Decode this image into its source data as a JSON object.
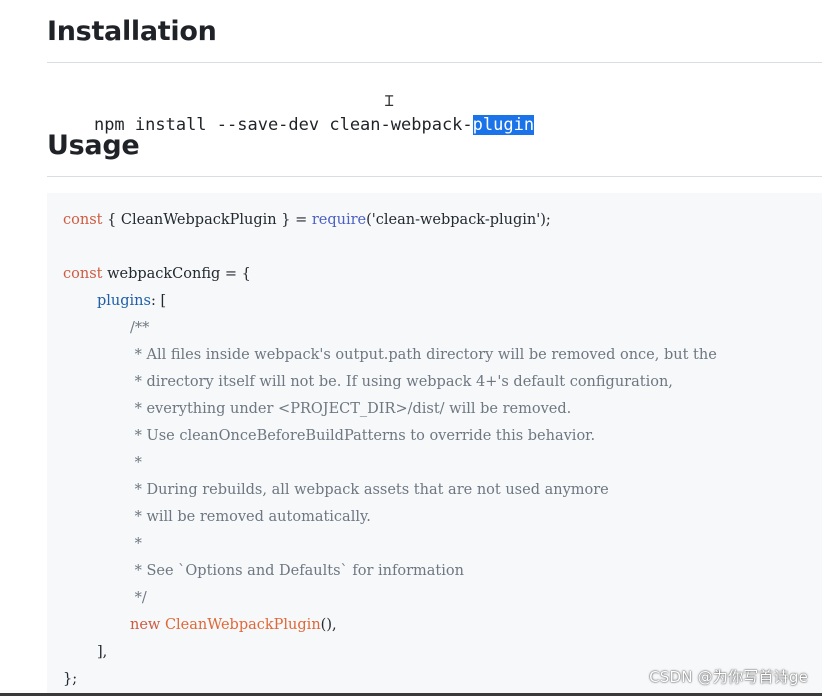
{
  "headings": {
    "installation": "Installation",
    "usage": "Usage"
  },
  "install": {
    "command_before": "npm install --save-dev clean-webpack-",
    "command_selected": "plugin"
  },
  "code": {
    "line1": {
      "const": "const",
      "braces": " { CleanWebpackPlugin } ",
      "eq": "= ",
      "require": "require",
      "arg": "('clean-webpack-plugin');"
    },
    "line3": {
      "const": "const",
      "name": " webpackConfig ",
      "eq": "= {"
    },
    "line4": {
      "plugins": "plugins",
      "rest": ": ["
    },
    "comment": [
      "/**",
      " * All files inside webpack's output.path directory will be removed once, but the",
      " * directory itself will not be. If using webpack 4+'s default configuration,",
      " * everything under <PROJECT_DIR>/dist/ will be removed.",
      " * Use cleanOnceBeforeBuildPatterns to override this behavior.",
      " *",
      " * During rebuilds, all webpack assets that are not used anymore",
      " * will be removed automatically.",
      " *",
      " * See `Options and Defaults` for information",
      " */"
    ],
    "line_new": {
      "new": "new",
      "cls": " CleanWebpackPlugin",
      "rest": "(),"
    },
    "close_array": "],",
    "close_obj": "};"
  },
  "watermark": "CSDN @为你写首诗ge",
  "colors": {
    "selection": "#1a73e8",
    "code_bg": "#f6f8fa",
    "keyword": "#cf5b41",
    "function": "#4b5fc4",
    "property": "#1e5fa8",
    "comment": "#6e7781"
  }
}
